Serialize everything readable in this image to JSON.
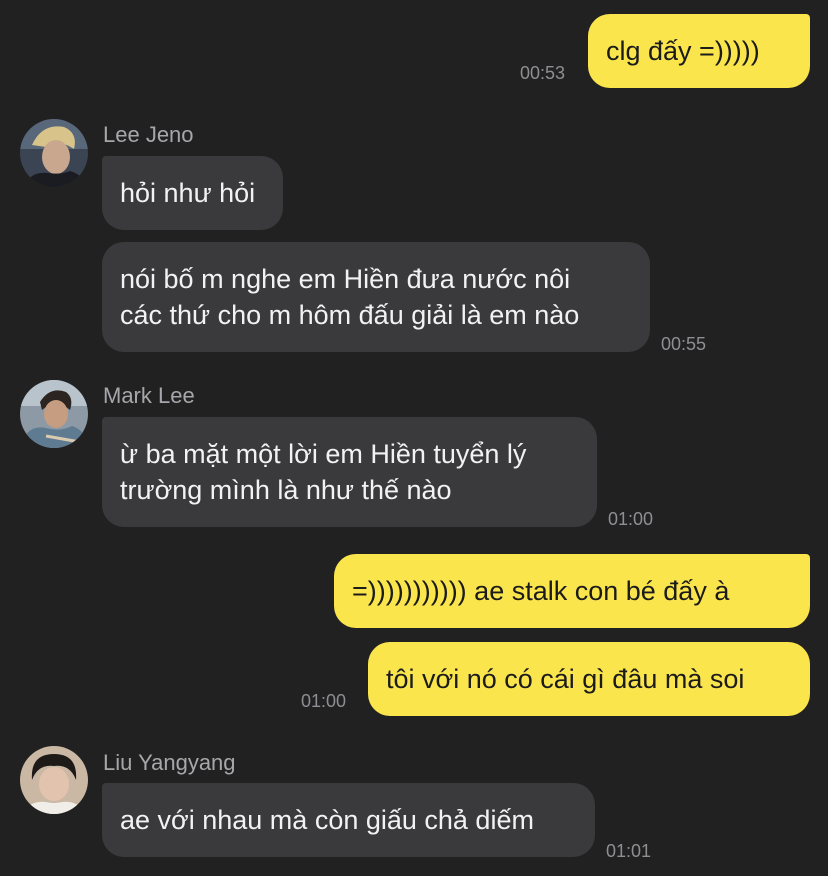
{
  "chat": {
    "messages": [
      {
        "direction": "outgoing",
        "text": "clg đấy =)))))",
        "time": "00:53"
      },
      {
        "direction": "incoming",
        "sender": "Lee Jeno",
        "avatar": "profile-photo-lee-jeno",
        "text": "hỏi như hỏi"
      },
      {
        "direction": "incoming",
        "sender": "Lee Jeno",
        "lines": [
          "nói bố m nghe em Hiền đưa nước nôi",
          "các thứ cho m hôm đấu giải là em nào"
        ],
        "time": "00:55"
      },
      {
        "direction": "incoming",
        "sender": "Mark Lee",
        "avatar": "profile-photo-mark-lee",
        "lines": [
          "ừ ba mặt một lời em Hiền tuyển lý",
          "trường mình là như thế nào"
        ],
        "time": "01:00"
      },
      {
        "direction": "outgoing",
        "text": "=))))))))))) ae stalk con bé đấy à"
      },
      {
        "direction": "outgoing",
        "text": "tôi với nó có cái gì đâu mà soi",
        "time": "01:00"
      },
      {
        "direction": "incoming",
        "sender": "Liu Yangyang",
        "avatar": "profile-photo-liu-yangyang",
        "text": "ae với nhau mà còn giấu chả diếm",
        "time": "01:01"
      }
    ]
  },
  "colors": {
    "background": "#212121",
    "incoming_bubble": "#3a3a3c",
    "outgoing_bubble": "#fbe54d",
    "timestamp": "#8e8e93",
    "sender_name": "#a7a7ab"
  }
}
